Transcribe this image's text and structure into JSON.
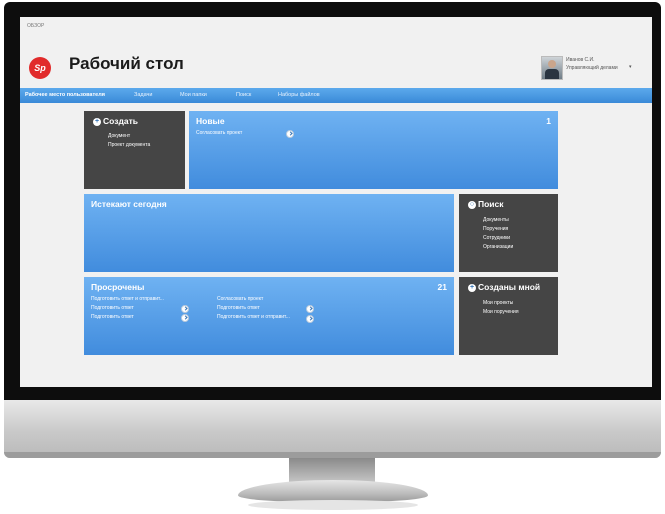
{
  "app": {
    "breadcrumb": "ОБЗОР",
    "logo_text": "Sp",
    "title": "Рабочий стол"
  },
  "user": {
    "name": "Иванов С.И.",
    "role": "Управляющий делами"
  },
  "nav": {
    "items": [
      {
        "label": "Рабочее место пользователя",
        "active": true
      },
      {
        "label": "Задачи"
      },
      {
        "label": "Мои папки"
      },
      {
        "label": "Поиск"
      },
      {
        "label": "Наборы файлов"
      }
    ]
  },
  "tiles": {
    "create": {
      "title": "Создать",
      "links": [
        "Документ",
        "Проект документа"
      ]
    },
    "new": {
      "title": "Новые",
      "count": "1",
      "links": [
        "Согласовать проект"
      ]
    },
    "expiring": {
      "title": "Истекают сегодня"
    },
    "search": {
      "title": "Поиск",
      "links": [
        "Документы",
        "Поручения",
        "Сотрудники",
        "Организации"
      ]
    },
    "overdue": {
      "title": "Просрочены",
      "count": "21",
      "col1": [
        "Подготовить ответ и отправит...",
        "Подготовить ответ",
        "Подготовить ответ"
      ],
      "col2": [
        "Согласовать проект",
        "Подготовить ответ",
        "Подготовить ответ и отправит..."
      ]
    },
    "created_by_me": {
      "title": "Созданы мной",
      "links": [
        "Мои проекты",
        "Мои поручения"
      ]
    }
  },
  "colors": {
    "accent_blue": "#418cdd",
    "tile_dark": "#454545",
    "logo_red": "#e12b2b"
  }
}
